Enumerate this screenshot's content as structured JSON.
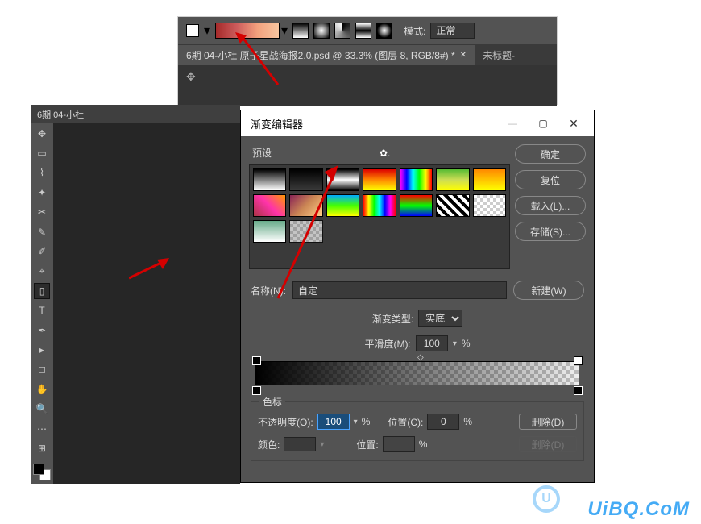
{
  "top": {
    "mode_label": "模式:",
    "mode_value": "正常",
    "doc_tab_active": "6期 04-小杜 原子星战海报2.0.psd @ 33.3% (图层 8, RGB/8#) *",
    "doc_tab_inactive": "未标题-"
  },
  "left": {
    "title": "6期 04-小杜"
  },
  "gedit": {
    "title": "渐变编辑器",
    "presets_label": "预设",
    "buttons": {
      "ok": "确定",
      "reset": "复位",
      "load": "载入(L)...",
      "save": "存储(S)...",
      "new": "新建(W)",
      "delete": "删除(D)",
      "delete2": "删除(D)"
    },
    "name_label": "名称(N):",
    "name_value": "自定",
    "grad_type_label": "渐变类型:",
    "grad_type_value": "实底",
    "smooth_label": "平滑度(M):",
    "smooth_value": "100",
    "pct": "%",
    "stops_title": "色标",
    "opacity_label": "不透明度(O):",
    "opacity_value": "100",
    "pos_label": "位置(C):",
    "pos_value": "0",
    "color_label": "颜色:",
    "pos2_label": "位置:"
  },
  "watermark": "UiBQ.CoM"
}
